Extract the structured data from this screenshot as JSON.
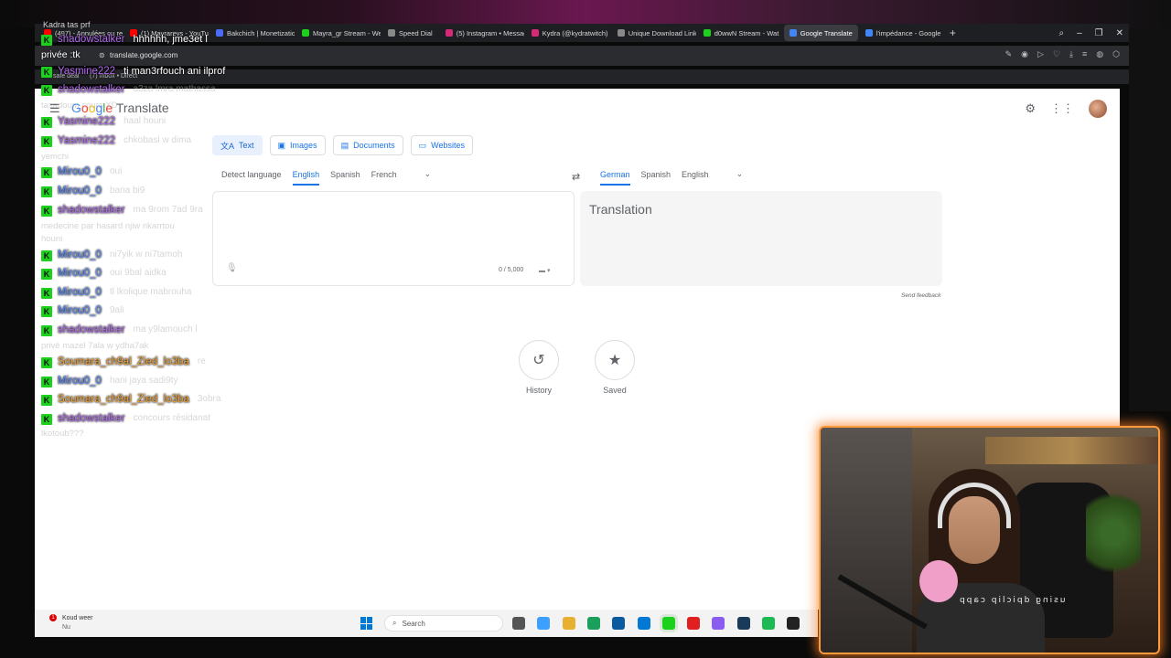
{
  "browser": {
    "tabs": [
      {
        "label": "(497) - Annulées ou re",
        "color": "#ff0000"
      },
      {
        "label": "(1) Mayrarevs - YouTu",
        "color": "#ff0000"
      },
      {
        "label": "Bakchich | Monetizatio",
        "color": "#4a6cf7"
      },
      {
        "label": "Mayra_gr Stream - We",
        "color": "#1cd11c"
      },
      {
        "label": "Speed Dial",
        "color": "#888888"
      },
      {
        "label": "(5) Instagram • Messag",
        "color": "#d62976"
      },
      {
        "label": "Kydra (@kydratwitch)",
        "color": "#d62976"
      },
      {
        "label": "Unique Download Link",
        "color": "#888888"
      },
      {
        "label": "d0wwN Stream - Wat",
        "color": "#1cd11c"
      },
      {
        "label": "Google Translate",
        "color": "#4285f4"
      },
      {
        "label": "l'impédance - Google",
        "color": "#4285f4"
      }
    ],
    "url": "translate.google.com",
    "bookmarks": [
      "safe deal",
      "(7) Inbox • Direct"
    ]
  },
  "translate": {
    "logo_google": "Google",
    "logo_translate": "Translate",
    "modes": [
      {
        "label": "Text",
        "icon": "translate-icon",
        "glyph": "文A"
      },
      {
        "label": "Images",
        "icon": "image-icon",
        "glyph": "▣"
      },
      {
        "label": "Documents",
        "icon": "document-icon",
        "glyph": "▤"
      },
      {
        "label": "Websites",
        "icon": "website-icon",
        "glyph": "▭"
      }
    ],
    "source_langs": {
      "detect": "Detect language",
      "selected": "English",
      "others": [
        "Spanish",
        "French"
      ]
    },
    "target_langs": {
      "selected": "German",
      "others": [
        "Spanish",
        "English"
      ]
    },
    "counter": "0 / 5,000",
    "target_placeholder": "Translation",
    "send_feedback": "Send feedback",
    "history_label": "History",
    "saved_label": "Saved"
  },
  "chat": {
    "top_lines": [
      "Kadra tas prf",
      "privée :tk"
    ],
    "messages": [
      {
        "user": "shadowstalker",
        "color": "purple",
        "text": "hhhhhh, jme3et l",
        "bright": true
      },
      {
        "user": "Yasmine222",
        "color": "purple",
        "text": "ti man3rfouch ani ilprof",
        "bright": true
      },
      {
        "user": "shadowstalker",
        "color": "purple",
        "text": "a3za lmra mathassa"
      },
      {
        "user": "Yasmine222",
        "color": "purple",
        "text": "haal houni"
      },
      {
        "user": "Yasmine222",
        "color": "purple",
        "text": "chkobasi w dima"
      },
      {
        "user": "Mirou0_0",
        "color": "blue",
        "text": "oui"
      },
      {
        "user": "Mirou0_0",
        "color": "blue",
        "text": "bana bi9"
      },
      {
        "user": "shadowstalker",
        "color": "purple",
        "text": "ma 9rom 7ad 9ra"
      },
      {
        "user": "Mirou0_0",
        "color": "blue",
        "text": "ni7yik w ni7tamoh"
      },
      {
        "user": "Mirou0_0",
        "color": "blue",
        "text": "oui 9bal aidka"
      },
      {
        "user": "Mirou0_0",
        "color": "blue",
        "text": "tl lkolique mabrouha"
      },
      {
        "user": "Mirou0_0",
        "color": "blue",
        "text": "9ali"
      },
      {
        "user": "shadowstalker",
        "color": "purple",
        "text": "ma y9lamouch l"
      },
      {
        "user": "Soumara_ch9al_Zied_lo3ba",
        "color": "orange",
        "text": "re"
      },
      {
        "user": "Mirou0_0",
        "color": "blue",
        "text": "hani jaya sadi9ty"
      },
      {
        "user": "Soumara_ch9al_Zied_lo3ba",
        "color": "orange",
        "text": "3obra"
      },
      {
        "user": "shadowstalker",
        "color": "purple",
        "text": "concours résidanat"
      }
    ],
    "continuations": [
      "tasadoum cours XD",
      "yemchi",
      "medecine par hasard njiw nkarrtou",
      "houni",
      "privé mazel 7ala w ydha7ak",
      "lkotoub???"
    ]
  },
  "taskbar": {
    "weather_title": "Koud weer",
    "weather_sub": "Nu",
    "badge": "1",
    "search_label": "Search",
    "app_colors": [
      "#555555",
      "#3ba0ff",
      "#e8b030",
      "#1aa05a",
      "#0a5aa0",
      "#0078d4",
      "#1cd11c",
      "#e02020",
      "#8a5cf0",
      "#1a3a5a",
      "#1db954",
      "#222222"
    ]
  },
  "overlay_text": "using dpiclip capp"
}
